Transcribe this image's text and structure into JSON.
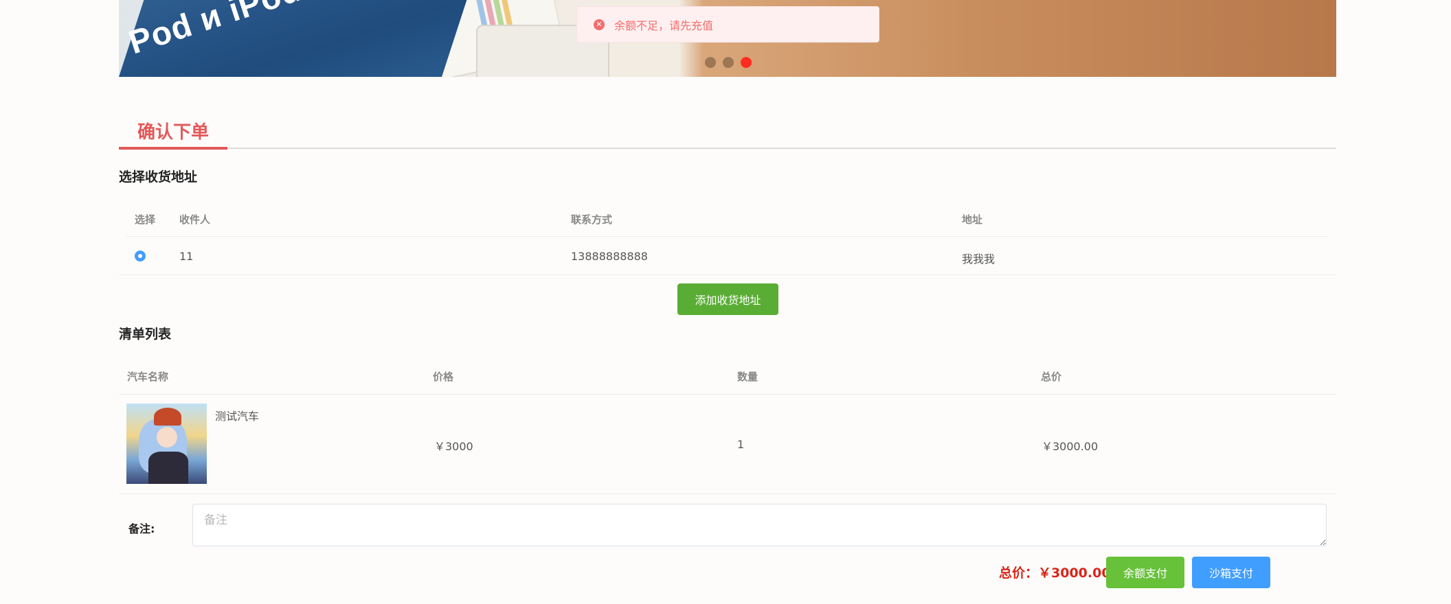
{
  "toast": {
    "icon": "error-circle-icon",
    "message": "余额不足，请先充值",
    "color": "#f56c6c"
  },
  "banner": {
    "box_text": "Pod и iPod",
    "slides": 3,
    "active_slide": 3,
    "active_color": "#ff2d1f"
  },
  "page": {
    "tab_label": "确认下单",
    "accent": "#e35858"
  },
  "address": {
    "heading": "选择收货地址",
    "columns": [
      "选择",
      "收件人",
      "联系方式",
      "地址"
    ],
    "rows": [
      {
        "selected": true,
        "recipient": "11",
        "phone": "13888888888",
        "address": "我我我"
      }
    ],
    "add_button": "添加收货地址"
  },
  "order": {
    "heading": "清单列表",
    "columns": [
      "汽车名称",
      "价格",
      "数量",
      "总价"
    ],
    "items": [
      {
        "name": "测试汽车",
        "price": "￥3000",
        "quantity": "1",
        "subtotal": "￥3000.00"
      }
    ]
  },
  "remark": {
    "label": "备注:",
    "placeholder": "备注",
    "value": ""
  },
  "checkout": {
    "total_label": "总价：",
    "total_value": "￥3000.00",
    "balance_pay": "余额支付",
    "sandbox_pay": "沙箱支付"
  }
}
